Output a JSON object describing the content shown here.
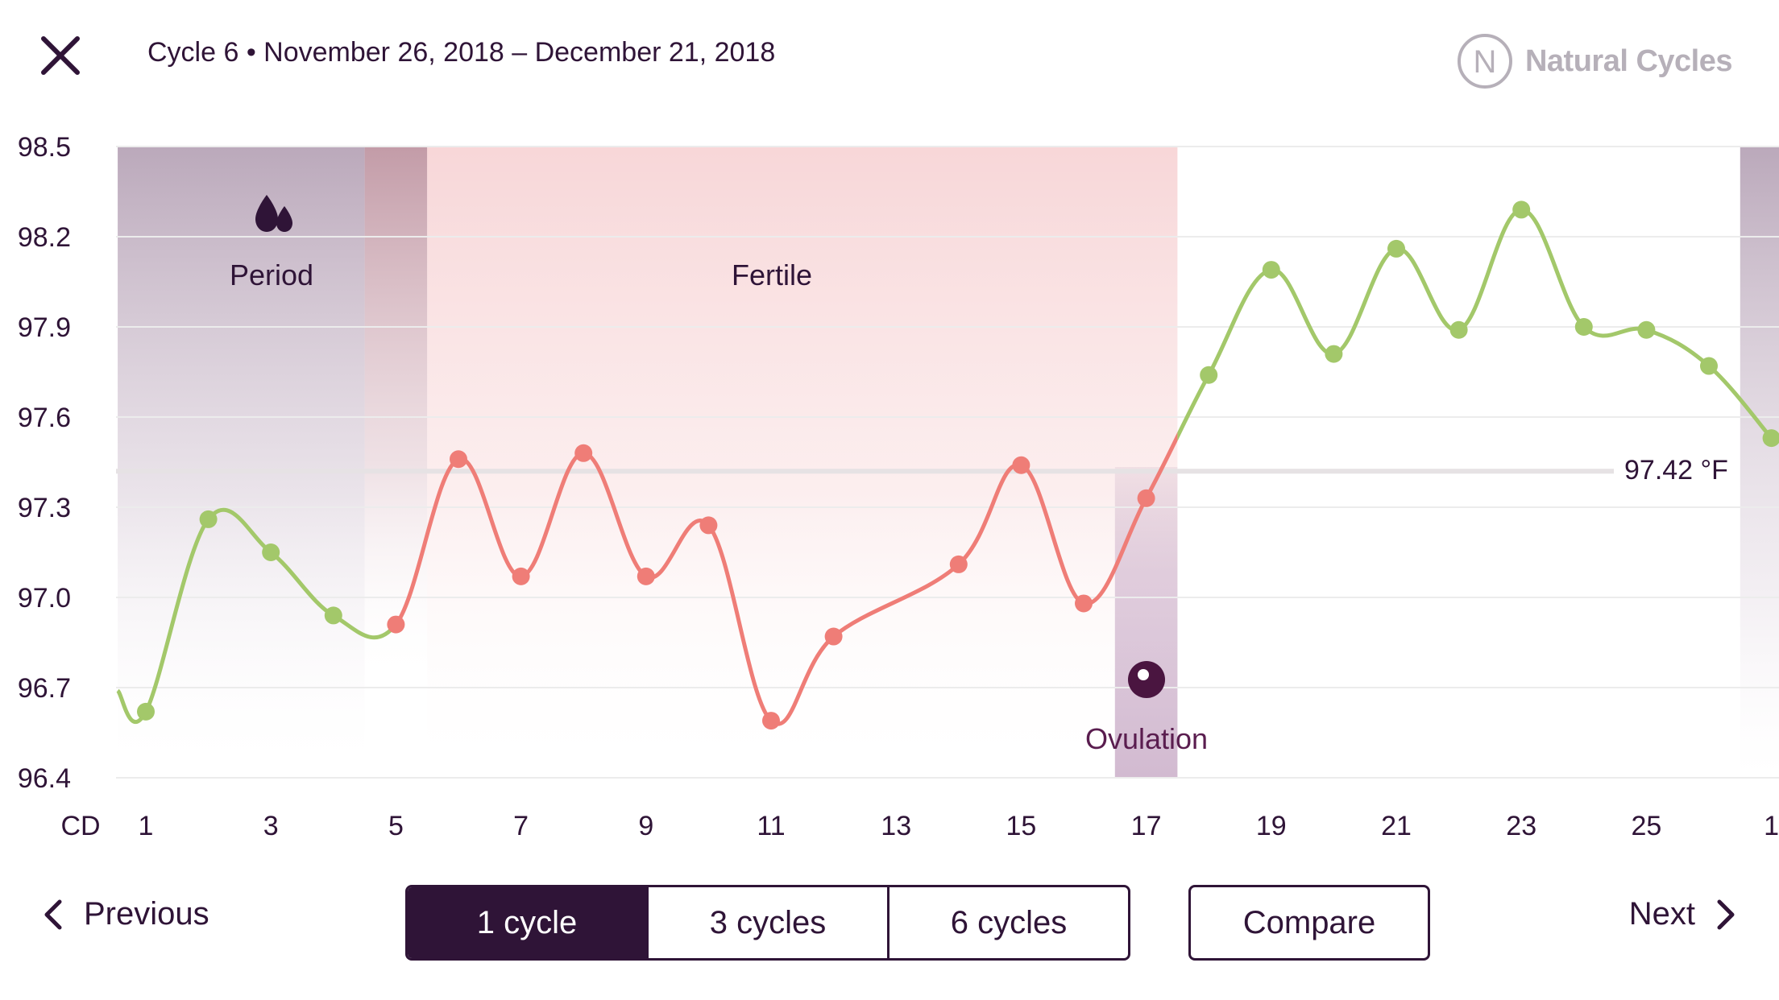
{
  "header": {
    "close_icon": "close-icon",
    "title": "Cycle 6 • November 26, 2018 – December 21, 2018",
    "brand_name": "Natural Cycles",
    "brand_logo_letter": "N"
  },
  "chart_data": {
    "type": "line",
    "title": "Cycle 6 • November 26, 2018 – December 21, 2018",
    "xlabel": "CD",
    "ylabel": "",
    "unit": "°F",
    "ylim": [
      96.4,
      98.5
    ],
    "yticks": [
      "98.5",
      "98.2",
      "97.9",
      "97.6",
      "97.3",
      "97.0",
      "96.7",
      "96.4"
    ],
    "ytick_values": [
      98.5,
      98.2,
      97.9,
      97.6,
      97.3,
      97.0,
      96.7,
      96.4
    ],
    "xlim": [
      0.55,
      27.7
    ],
    "xticks": [
      {
        "x": 1,
        "label": "1"
      },
      {
        "x": 3,
        "label": "3"
      },
      {
        "x": 5,
        "label": "5"
      },
      {
        "x": 7,
        "label": "7"
      },
      {
        "x": 9,
        "label": "9"
      },
      {
        "x": 11,
        "label": "11"
      },
      {
        "x": 13,
        "label": "13"
      },
      {
        "x": 15,
        "label": "15"
      },
      {
        "x": 17,
        "label": "17"
      },
      {
        "x": 19,
        "label": "19"
      },
      {
        "x": 21,
        "label": "21"
      },
      {
        "x": 23,
        "label": "23"
      },
      {
        "x": 25,
        "label": "25"
      },
      {
        "x": 27,
        "label": "1"
      }
    ],
    "grid": true,
    "coverline": {
      "value": 97.42,
      "label": "97.42 °F"
    },
    "bands": [
      {
        "name": "Period",
        "from": 0.55,
        "to": 5.5,
        "kind": "period",
        "label": "Period"
      },
      {
        "name": "Fertile",
        "from": 5.5,
        "to": 17.5,
        "kind": "fertile",
        "label": "Fertile"
      },
      {
        "name": "Ovulation",
        "from": 16.5,
        "to": 17.5,
        "kind": "ovulation",
        "label": "Ovulation"
      },
      {
        "name": "Next period",
        "from": 26.5,
        "to": 27.7,
        "kind": "period",
        "label": ""
      }
    ],
    "series": [
      {
        "name": "Temperature",
        "points": [
          {
            "x": 0.55,
            "y": 96.69,
            "status": "green",
            "marker": false
          },
          {
            "x": 1,
            "y": 96.62,
            "status": "green",
            "marker": true
          },
          {
            "x": 2,
            "y": 97.26,
            "status": "green",
            "marker": true
          },
          {
            "x": 3,
            "y": 97.15,
            "status": "green",
            "marker": true
          },
          {
            "x": 4,
            "y": 96.94,
            "status": "green",
            "marker": true
          },
          {
            "x": 5,
            "y": 96.91,
            "status": "red",
            "marker": true
          },
          {
            "x": 6,
            "y": 97.46,
            "status": "red",
            "marker": true
          },
          {
            "x": 7,
            "y": 97.07,
            "status": "red",
            "marker": true
          },
          {
            "x": 8,
            "y": 97.48,
            "status": "red",
            "marker": true
          },
          {
            "x": 9,
            "y": 97.07,
            "status": "red",
            "marker": true
          },
          {
            "x": 10,
            "y": 97.24,
            "status": "red",
            "marker": true
          },
          {
            "x": 11,
            "y": 96.59,
            "status": "red",
            "marker": true
          },
          {
            "x": 12,
            "y": 96.87,
            "status": "red",
            "marker": true
          },
          {
            "x": 14,
            "y": 97.11,
            "status": "red",
            "marker": true
          },
          {
            "x": 15,
            "y": 97.44,
            "status": "red",
            "marker": true
          },
          {
            "x": 16,
            "y": 96.98,
            "status": "red",
            "marker": true
          },
          {
            "x": 17,
            "y": 97.33,
            "status": "red",
            "marker": true
          },
          {
            "x": 18,
            "y": 97.74,
            "status": "green",
            "marker": true
          },
          {
            "x": 19,
            "y": 98.09,
            "status": "green",
            "marker": true
          },
          {
            "x": 20,
            "y": 97.81,
            "status": "green",
            "marker": true
          },
          {
            "x": 21,
            "y": 98.16,
            "status": "green",
            "marker": true
          },
          {
            "x": 22,
            "y": 97.89,
            "status": "green",
            "marker": true
          },
          {
            "x": 23,
            "y": 98.29,
            "status": "green",
            "marker": true
          },
          {
            "x": 24,
            "y": 97.9,
            "status": "green",
            "marker": true
          },
          {
            "x": 25,
            "y": 97.89,
            "status": "green",
            "marker": true
          },
          {
            "x": 26,
            "y": 97.77,
            "status": "green",
            "marker": true
          },
          {
            "x": 27,
            "y": 97.53,
            "status": "green",
            "marker": true
          }
        ]
      }
    ],
    "annotations": [
      {
        "text": "Period",
        "icon": "drops-icon"
      },
      {
        "text": "Fertile"
      },
      {
        "text": "Ovulation",
        "icon": "ovulation-icon"
      }
    ],
    "colors": {
      "green": "#a3c86a",
      "red": "#ef7d77",
      "period": "#a890a8",
      "fertile": "#f6cfd1",
      "ovulation": "#b89ab6",
      "grid": "#ececec",
      "coverline": "#e6e2e4",
      "text": "#2f1437"
    }
  },
  "footer": {
    "previous_label": "Previous",
    "next_label": "Next",
    "range_options": [
      {
        "label": "1 cycle",
        "active": true
      },
      {
        "label": "3 cycles",
        "active": false
      },
      {
        "label": "6 cycles",
        "active": false
      }
    ],
    "compare_label": "Compare"
  }
}
